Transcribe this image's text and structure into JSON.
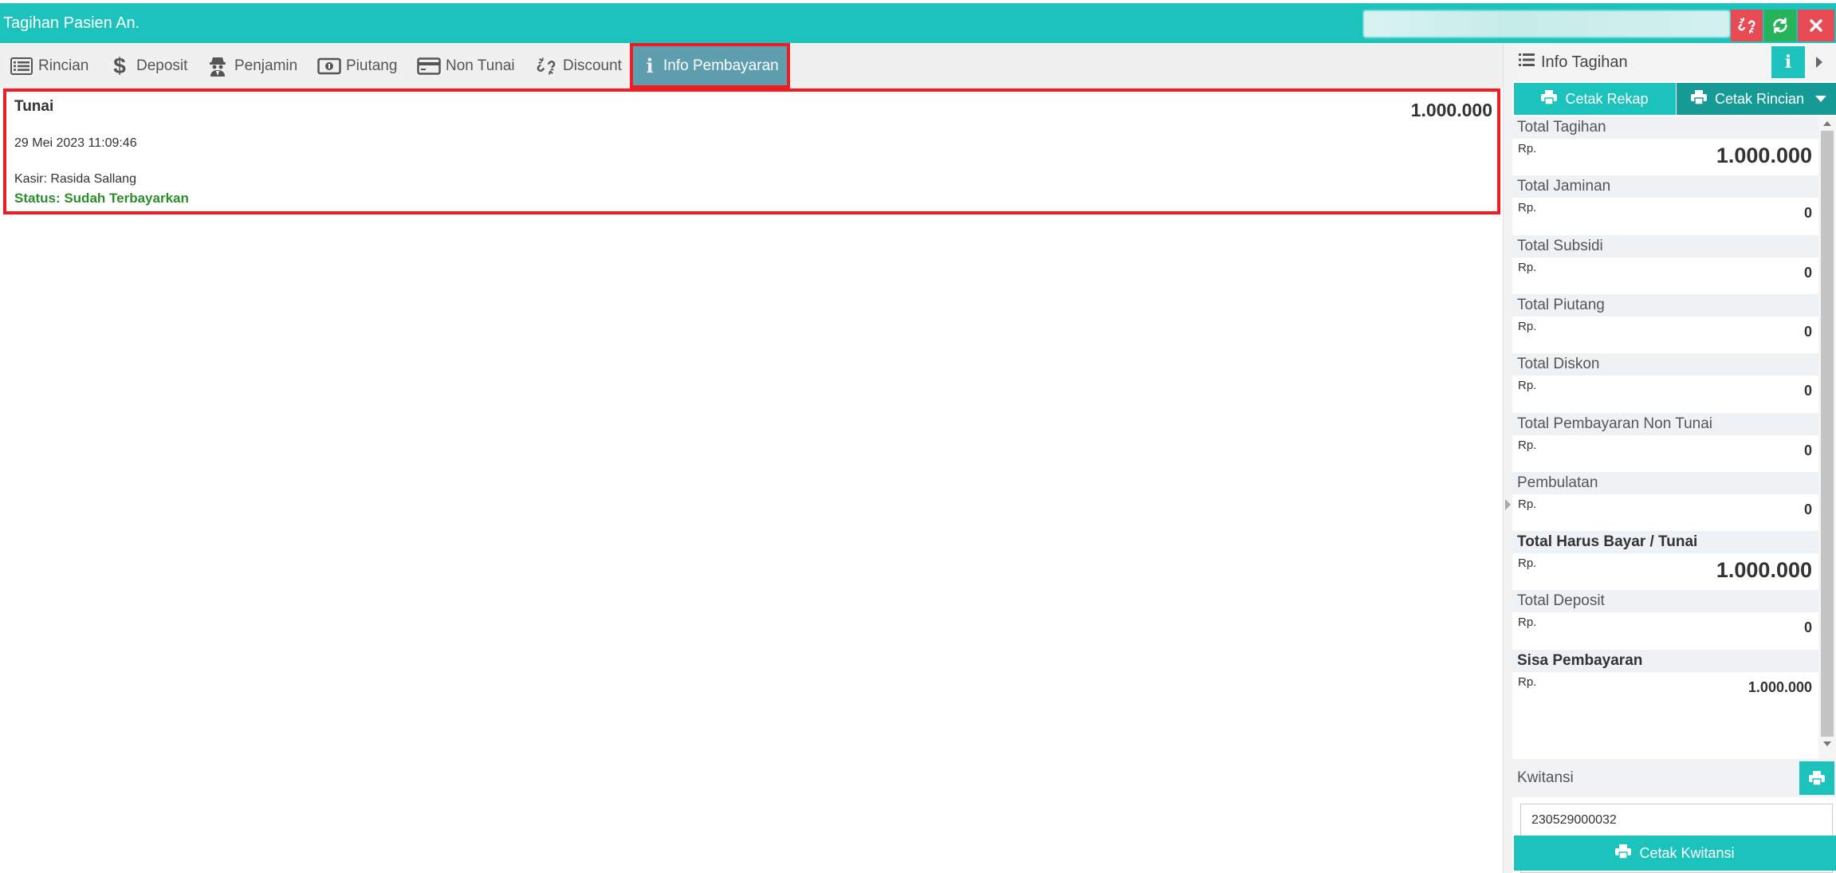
{
  "window": {
    "title": "Tagihan Pasien An."
  },
  "tabs": [
    {
      "label": "Rincian",
      "icon": "list-icon"
    },
    {
      "label": "Deposit",
      "icon": "dollar-icon"
    },
    {
      "label": "Penjamin",
      "icon": "spy-icon"
    },
    {
      "label": "Piutang",
      "icon": "money-icon"
    },
    {
      "label": "Non Tunai",
      "icon": "credit-card-icon"
    },
    {
      "label": "Discount",
      "icon": "unlink-icon"
    },
    {
      "label": "Info Pembayaran",
      "icon": "info-icon",
      "active": true
    }
  ],
  "payment": {
    "method": "Tunai",
    "amount": "1.000.000",
    "date": "29 Mei 2023 11:09:46",
    "kasir": "Kasir: Rasida Sallang",
    "status": "Status: Sudah Terbayarkan"
  },
  "panel": {
    "title": "Info Tagihan",
    "print_rekap": "Cetak Rekap",
    "print_rincian": "Cetak Rincian",
    "currency": "Rp.",
    "items": [
      {
        "label": "Total Tagihan",
        "value": "1.000.000",
        "big": true,
        "bold": false
      },
      {
        "label": "Total Jaminan",
        "value": "0",
        "big": false,
        "bold": false
      },
      {
        "label": "Total Subsidi",
        "value": "0",
        "big": false,
        "bold": false
      },
      {
        "label": "Total Piutang",
        "value": "0",
        "big": false,
        "bold": false
      },
      {
        "label": "Total Diskon",
        "value": "0",
        "big": false,
        "bold": false
      },
      {
        "label": "Total Pembayaran Non Tunai",
        "value": "0",
        "big": false,
        "bold": false
      },
      {
        "label": "Pembulatan",
        "value": "0",
        "big": false,
        "bold": false
      },
      {
        "label": "Total Harus Bayar / Tunai",
        "value": "1.000.000",
        "big": true,
        "bold": true
      },
      {
        "label": "Total Deposit",
        "value": "0",
        "big": false,
        "bold": false
      },
      {
        "label": "Sisa Pembayaran",
        "value": "1.000.000",
        "big": false,
        "bold": true
      }
    ],
    "kwitansi_label": "Kwitansi",
    "kwitansi_number": "230529000032",
    "kwitansi_note": "-",
    "print_kwitansi": "Cetak Kwitansi"
  },
  "colors": {
    "accent": "#1cc3bd",
    "accent_dark": "#169a95",
    "tab_active": "#5f9eae",
    "highlight": "#ef1c24",
    "status_ok": "#2d8c2d",
    "danger": "#e94b55",
    "success": "#27b35a"
  }
}
